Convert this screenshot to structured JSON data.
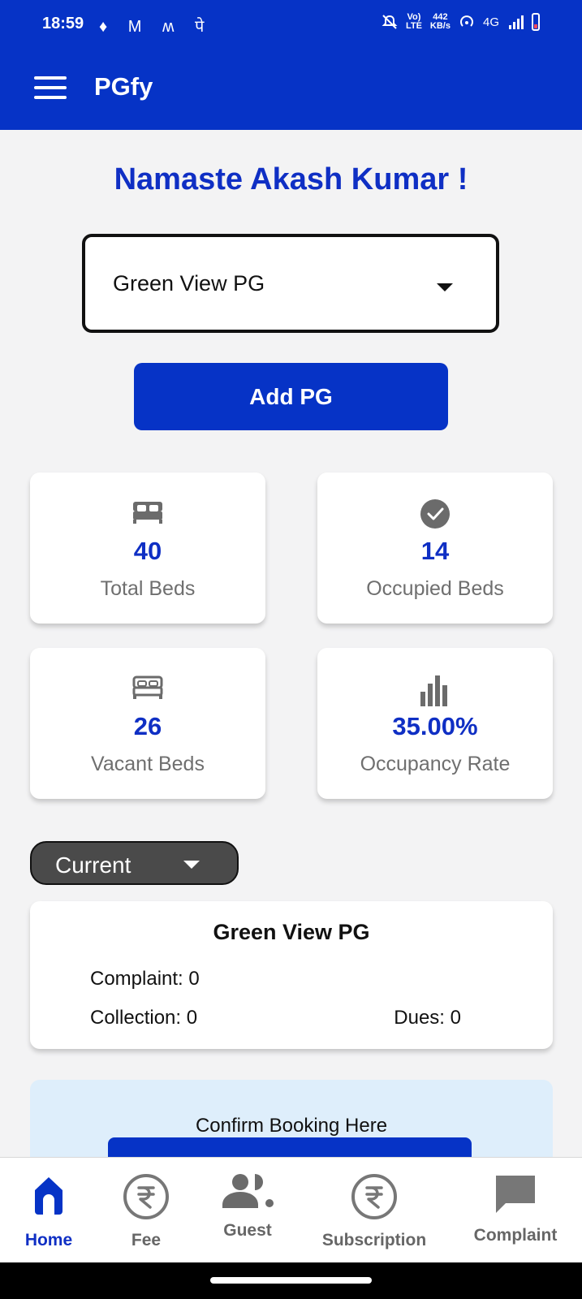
{
  "status_bar": {
    "time": "18:59",
    "left_icons": "♦ M ʍ पे",
    "network_speed": "442\nKB/s",
    "network_type": "4G",
    "volte": "Vo)\nLTE"
  },
  "app_bar": {
    "title": "PGfy"
  },
  "greeting": "Namaste Akash Kumar !",
  "pg_select": {
    "value": "Green View PG"
  },
  "add_pg_label": "Add PG",
  "stats": [
    {
      "value": "40",
      "label": "Total Beds",
      "icon": "bed-icon"
    },
    {
      "value": "14",
      "label": "Occupied Beds",
      "icon": "check-circle-icon"
    },
    {
      "value": "26",
      "label": "Vacant Beds",
      "icon": "bed-outline-icon"
    },
    {
      "value": "35.00%",
      "label": "Occupancy Rate",
      "icon": "bar-chart-icon"
    }
  ],
  "period_select": {
    "value": "Current"
  },
  "summary": {
    "title": "Green View PG",
    "complaint": "Complaint: 0",
    "collection": "Collection: 0",
    "dues": "Dues: 0"
  },
  "booking": {
    "text": "Confirm Booking Here"
  },
  "bottom_nav": [
    {
      "label": "Home",
      "icon": "home-icon",
      "active": true
    },
    {
      "label": "Fee",
      "icon": "rupee-icon"
    },
    {
      "label": "Guest",
      "icon": "guest-icon"
    },
    {
      "label": "Subscription",
      "icon": "rupee-icon"
    },
    {
      "label": "Complaint",
      "icon": "chat-icon"
    }
  ],
  "colors": {
    "primary": "#0633c6",
    "accent_text": "#0f2fc4",
    "background": "#f3f3f4",
    "booking_bg": "#deeefb"
  }
}
